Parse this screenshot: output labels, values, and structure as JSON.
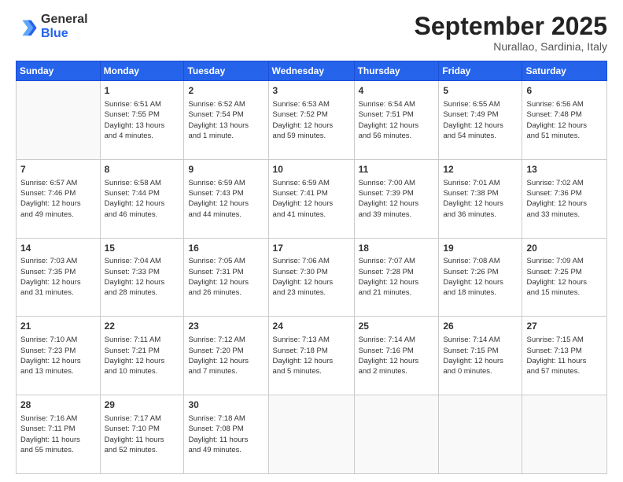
{
  "header": {
    "logo_general": "General",
    "logo_blue": "Blue",
    "title": "September 2025",
    "location": "Nurallao, Sardinia, Italy"
  },
  "calendar": {
    "days_of_week": [
      "Sunday",
      "Monday",
      "Tuesday",
      "Wednesday",
      "Thursday",
      "Friday",
      "Saturday"
    ],
    "weeks": [
      [
        {
          "day": "",
          "info": ""
        },
        {
          "day": "1",
          "info": "Sunrise: 6:51 AM\nSunset: 7:55 PM\nDaylight: 13 hours\nand 4 minutes."
        },
        {
          "day": "2",
          "info": "Sunrise: 6:52 AM\nSunset: 7:54 PM\nDaylight: 13 hours\nand 1 minute."
        },
        {
          "day": "3",
          "info": "Sunrise: 6:53 AM\nSunset: 7:52 PM\nDaylight: 12 hours\nand 59 minutes."
        },
        {
          "day": "4",
          "info": "Sunrise: 6:54 AM\nSunset: 7:51 PM\nDaylight: 12 hours\nand 56 minutes."
        },
        {
          "day": "5",
          "info": "Sunrise: 6:55 AM\nSunset: 7:49 PM\nDaylight: 12 hours\nand 54 minutes."
        },
        {
          "day": "6",
          "info": "Sunrise: 6:56 AM\nSunset: 7:48 PM\nDaylight: 12 hours\nand 51 minutes."
        }
      ],
      [
        {
          "day": "7",
          "info": "Sunrise: 6:57 AM\nSunset: 7:46 PM\nDaylight: 12 hours\nand 49 minutes."
        },
        {
          "day": "8",
          "info": "Sunrise: 6:58 AM\nSunset: 7:44 PM\nDaylight: 12 hours\nand 46 minutes."
        },
        {
          "day": "9",
          "info": "Sunrise: 6:59 AM\nSunset: 7:43 PM\nDaylight: 12 hours\nand 44 minutes."
        },
        {
          "day": "10",
          "info": "Sunrise: 6:59 AM\nSunset: 7:41 PM\nDaylight: 12 hours\nand 41 minutes."
        },
        {
          "day": "11",
          "info": "Sunrise: 7:00 AM\nSunset: 7:39 PM\nDaylight: 12 hours\nand 39 minutes."
        },
        {
          "day": "12",
          "info": "Sunrise: 7:01 AM\nSunset: 7:38 PM\nDaylight: 12 hours\nand 36 minutes."
        },
        {
          "day": "13",
          "info": "Sunrise: 7:02 AM\nSunset: 7:36 PM\nDaylight: 12 hours\nand 33 minutes."
        }
      ],
      [
        {
          "day": "14",
          "info": "Sunrise: 7:03 AM\nSunset: 7:35 PM\nDaylight: 12 hours\nand 31 minutes."
        },
        {
          "day": "15",
          "info": "Sunrise: 7:04 AM\nSunset: 7:33 PM\nDaylight: 12 hours\nand 28 minutes."
        },
        {
          "day": "16",
          "info": "Sunrise: 7:05 AM\nSunset: 7:31 PM\nDaylight: 12 hours\nand 26 minutes."
        },
        {
          "day": "17",
          "info": "Sunrise: 7:06 AM\nSunset: 7:30 PM\nDaylight: 12 hours\nand 23 minutes."
        },
        {
          "day": "18",
          "info": "Sunrise: 7:07 AM\nSunset: 7:28 PM\nDaylight: 12 hours\nand 21 minutes."
        },
        {
          "day": "19",
          "info": "Sunrise: 7:08 AM\nSunset: 7:26 PM\nDaylight: 12 hours\nand 18 minutes."
        },
        {
          "day": "20",
          "info": "Sunrise: 7:09 AM\nSunset: 7:25 PM\nDaylight: 12 hours\nand 15 minutes."
        }
      ],
      [
        {
          "day": "21",
          "info": "Sunrise: 7:10 AM\nSunset: 7:23 PM\nDaylight: 12 hours\nand 13 minutes."
        },
        {
          "day": "22",
          "info": "Sunrise: 7:11 AM\nSunset: 7:21 PM\nDaylight: 12 hours\nand 10 minutes."
        },
        {
          "day": "23",
          "info": "Sunrise: 7:12 AM\nSunset: 7:20 PM\nDaylight: 12 hours\nand 7 minutes."
        },
        {
          "day": "24",
          "info": "Sunrise: 7:13 AM\nSunset: 7:18 PM\nDaylight: 12 hours\nand 5 minutes."
        },
        {
          "day": "25",
          "info": "Sunrise: 7:14 AM\nSunset: 7:16 PM\nDaylight: 12 hours\nand 2 minutes."
        },
        {
          "day": "26",
          "info": "Sunrise: 7:14 AM\nSunset: 7:15 PM\nDaylight: 12 hours\nand 0 minutes."
        },
        {
          "day": "27",
          "info": "Sunrise: 7:15 AM\nSunset: 7:13 PM\nDaylight: 11 hours\nand 57 minutes."
        }
      ],
      [
        {
          "day": "28",
          "info": "Sunrise: 7:16 AM\nSunset: 7:11 PM\nDaylight: 11 hours\nand 55 minutes."
        },
        {
          "day": "29",
          "info": "Sunrise: 7:17 AM\nSunset: 7:10 PM\nDaylight: 11 hours\nand 52 minutes."
        },
        {
          "day": "30",
          "info": "Sunrise: 7:18 AM\nSunset: 7:08 PM\nDaylight: 11 hours\nand 49 minutes."
        },
        {
          "day": "",
          "info": ""
        },
        {
          "day": "",
          "info": ""
        },
        {
          "day": "",
          "info": ""
        },
        {
          "day": "",
          "info": ""
        }
      ]
    ]
  }
}
